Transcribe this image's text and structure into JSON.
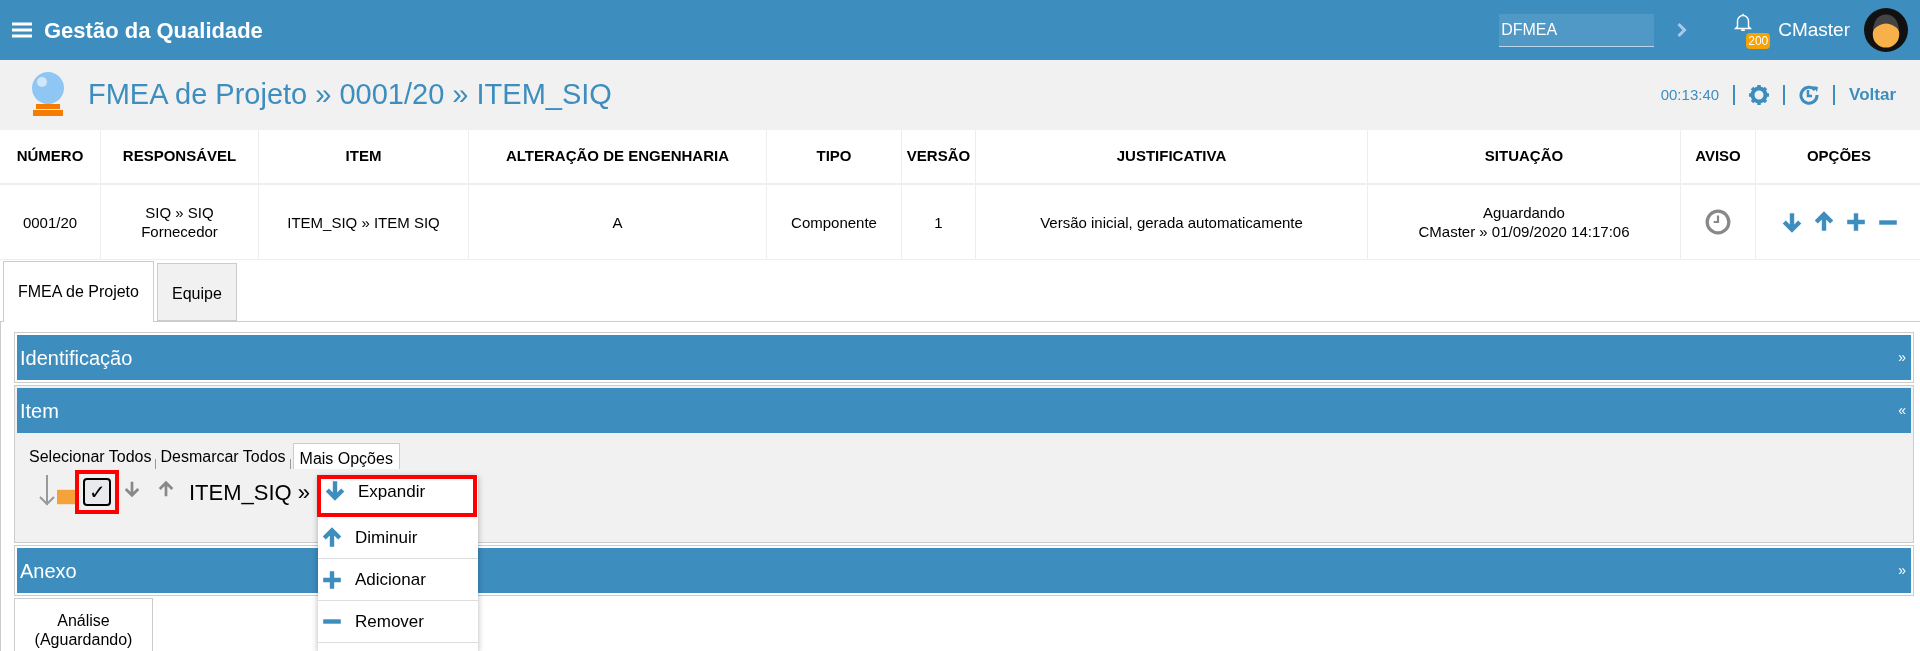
{
  "app": {
    "title": "Gestão da Qualidade",
    "search_value": "DFMEA",
    "notification_count": "200",
    "user": "CMaster"
  },
  "page": {
    "title": "FMEA de Projeto » 0001/20 » ITEM_SIQ",
    "timer": "00:13:40",
    "back_link": "Voltar"
  },
  "table": {
    "columns": [
      "NÚMERO",
      "RESPONSÁVEL",
      "ITEM",
      "ALTERAÇÃO DE ENGENHARIA",
      "TIPO",
      "VERSÃO",
      "JUSTIFICATIVA",
      "SITUAÇÃO",
      "AVISO",
      "OPÇÕES"
    ],
    "rows": [
      {
        "numero": "0001/20",
        "responsavel": "SIQ » SIQ Fornecedor",
        "item": "ITEM_SIQ » ITEM SIQ",
        "alteracao": "A",
        "tipo": "Componente",
        "versao": "1",
        "justificativa": "Versão inicial, gerada automaticamente",
        "situacao": [
          "Aguardando",
          "CMaster » 01/09/2020 14:17:06"
        ]
      }
    ]
  },
  "tabs": [
    {
      "label": "FMEA de Projeto",
      "selected": true
    },
    {
      "label": "Equipe",
      "selected": false
    }
  ],
  "sections": [
    {
      "title": "Identificação",
      "expanded": false,
      "toggle": "»"
    },
    {
      "title": "Item",
      "expanded": true,
      "toggle": "«",
      "links": [
        "Selecionar Todos",
        "Desmarcar Todos"
      ],
      "more_button": "Mais Opções",
      "tree_node": {
        "label": "ITEM_SIQ »",
        "checkbox": "✓",
        "checked": true,
        "highlighted": true
      }
    },
    {
      "title": "Anexo",
      "expanded": false,
      "toggle": "»"
    }
  ],
  "menu": {
    "items": [
      {
        "kind": "down",
        "label": "Expandir",
        "highlighted": true
      },
      {
        "kind": "up",
        "label": "Diminuir",
        "highlighted": false
      },
      {
        "kind": "plus",
        "label": "Adicionar",
        "highlighted": false
      },
      {
        "kind": "minus",
        "label": "Remover",
        "highlighted": false
      }
    ]
  },
  "bottom_tabs": [
    {
      "label": "Análise (Aguardando)"
    }
  ]
}
